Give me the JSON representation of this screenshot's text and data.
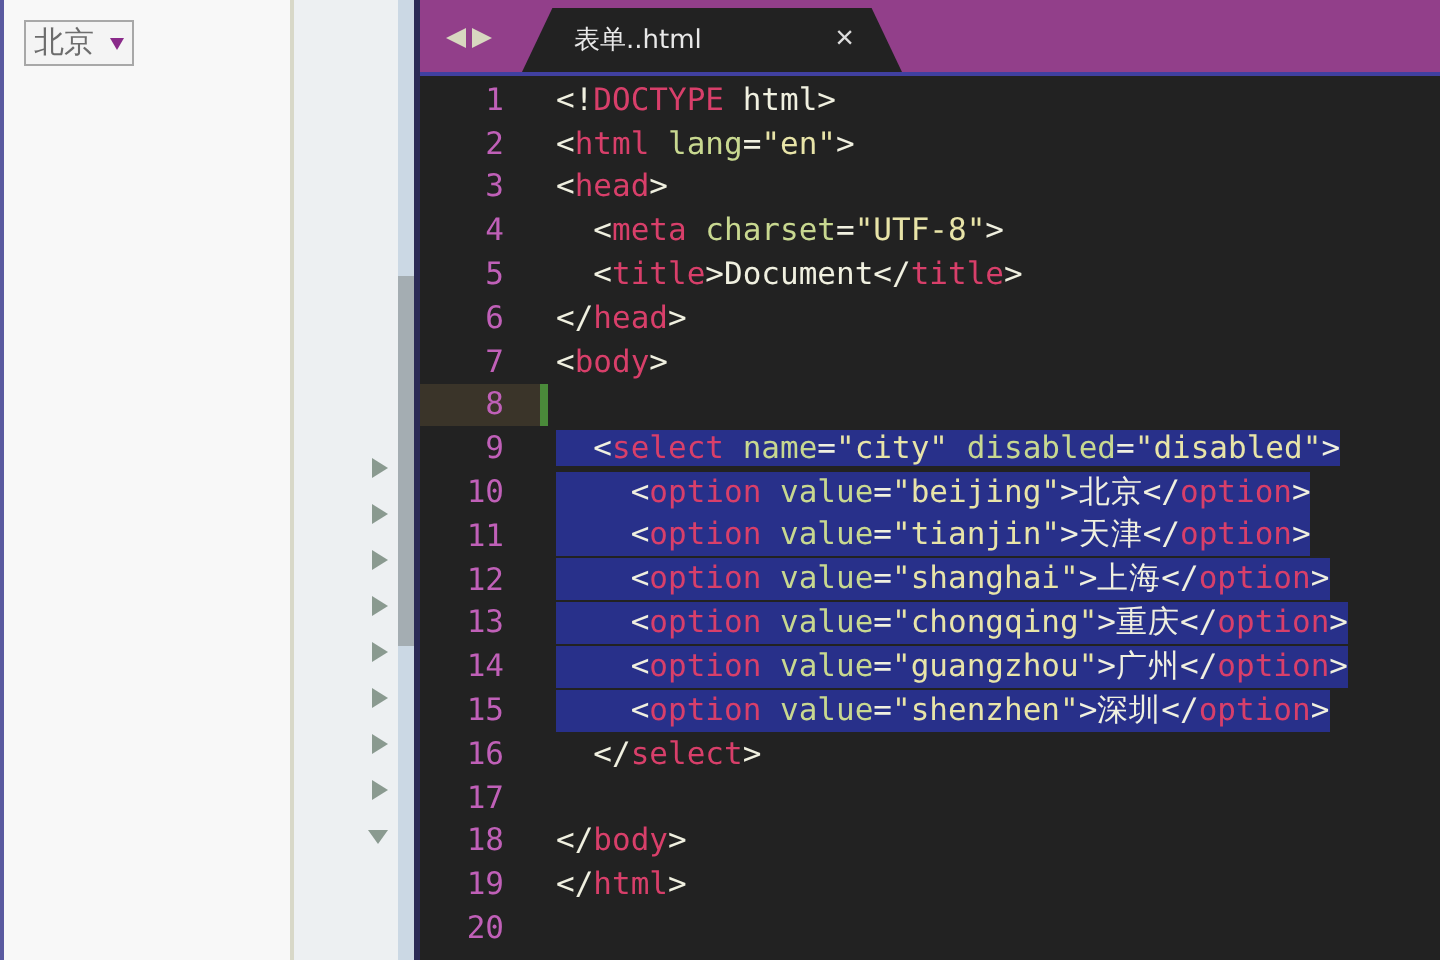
{
  "browser": {
    "select": {
      "value": "北京",
      "disabled": true
    }
  },
  "fold_markers": [
    {
      "kind": "collapsed"
    },
    {
      "kind": "collapsed"
    },
    {
      "kind": "collapsed"
    },
    {
      "kind": "collapsed"
    },
    {
      "kind": "collapsed"
    },
    {
      "kind": "collapsed"
    },
    {
      "kind": "collapsed"
    },
    {
      "kind": "collapsed"
    },
    {
      "kind": "expanded"
    }
  ],
  "editor": {
    "tab": {
      "title": "表单..html",
      "close": "×",
      "selected": true
    },
    "lines": [
      {
        "number": "1",
        "current": false,
        "selected": false,
        "tokens": [
          {
            "kind": "punct",
            "text": "<!"
          },
          {
            "kind": "tag",
            "text": "DOCTYPE"
          },
          {
            "kind": "plain",
            "text": " html>"
          }
        ]
      },
      {
        "number": "2",
        "current": false,
        "selected": false,
        "tokens": [
          {
            "kind": "punct",
            "text": "<"
          },
          {
            "kind": "tag",
            "text": "html"
          },
          {
            "kind": "attr",
            "text": " lang"
          },
          {
            "kind": "punct",
            "text": "="
          },
          {
            "kind": "string",
            "text": "\"en\""
          },
          {
            "kind": "punct",
            "text": ">"
          }
        ]
      },
      {
        "number": "3",
        "current": false,
        "selected": false,
        "tokens": [
          {
            "kind": "punct",
            "text": "<"
          },
          {
            "kind": "tag",
            "text": "head"
          },
          {
            "kind": "punct",
            "text": ">"
          }
        ]
      },
      {
        "number": "4",
        "current": false,
        "selected": false,
        "tokens": [
          {
            "kind": "punct",
            "text": "  <"
          },
          {
            "kind": "tag",
            "text": "meta"
          },
          {
            "kind": "attr",
            "text": " charset"
          },
          {
            "kind": "punct",
            "text": "="
          },
          {
            "kind": "string",
            "text": "\"UTF-8\""
          },
          {
            "kind": "punct",
            "text": ">"
          }
        ]
      },
      {
        "number": "5",
        "current": false,
        "selected": false,
        "tokens": [
          {
            "kind": "punct",
            "text": "  <"
          },
          {
            "kind": "tag",
            "text": "title"
          },
          {
            "kind": "plain",
            "text": ">Document</"
          },
          {
            "kind": "tag",
            "text": "title"
          },
          {
            "kind": "punct",
            "text": ">"
          }
        ]
      },
      {
        "number": "6",
        "current": false,
        "selected": false,
        "tokens": [
          {
            "kind": "punct",
            "text": "</"
          },
          {
            "kind": "tag",
            "text": "head"
          },
          {
            "kind": "punct",
            "text": ">"
          }
        ]
      },
      {
        "number": "7",
        "current": false,
        "selected": false,
        "tokens": [
          {
            "kind": "punct",
            "text": "<"
          },
          {
            "kind": "tag",
            "text": "body"
          },
          {
            "kind": "punct",
            "text": ">"
          }
        ]
      },
      {
        "number": "8",
        "current": true,
        "selected": false
      },
      {
        "number": "9",
        "current": false,
        "selected": true,
        "tokens": [
          {
            "kind": "punct",
            "text": "  <"
          },
          {
            "kind": "tag",
            "text": "select"
          },
          {
            "kind": "attr",
            "text": " name"
          },
          {
            "kind": "punct",
            "text": "="
          },
          {
            "kind": "string",
            "text": "\"city\""
          },
          {
            "kind": "attr",
            "text": " disabled"
          },
          {
            "kind": "punct",
            "text": "="
          },
          {
            "kind": "string",
            "text": "\"disabled\""
          },
          {
            "kind": "punct",
            "text": ">"
          }
        ]
      },
      {
        "number": "10",
        "current": false,
        "selected": true,
        "tokens": [
          {
            "kind": "punct",
            "text": "    <"
          },
          {
            "kind": "tag",
            "text": "option"
          },
          {
            "kind": "attr",
            "text": " value"
          },
          {
            "kind": "punct",
            "text": "="
          },
          {
            "kind": "string",
            "text": "\"beijing\""
          },
          {
            "kind": "plain",
            "text": ">北京</"
          },
          {
            "kind": "tag",
            "text": "option"
          },
          {
            "kind": "punct",
            "text": ">"
          }
        ]
      },
      {
        "number": "11",
        "current": false,
        "selected": true,
        "tokens": [
          {
            "kind": "punct",
            "text": "    <"
          },
          {
            "kind": "tag",
            "text": "option"
          },
          {
            "kind": "attr",
            "text": " value"
          },
          {
            "kind": "punct",
            "text": "="
          },
          {
            "kind": "string",
            "text": "\"tianjin\""
          },
          {
            "kind": "plain",
            "text": ">天津</"
          },
          {
            "kind": "tag",
            "text": "option"
          },
          {
            "kind": "punct",
            "text": ">"
          }
        ]
      },
      {
        "number": "12",
        "current": false,
        "selected": true,
        "tokens": [
          {
            "kind": "punct",
            "text": "    <"
          },
          {
            "kind": "tag",
            "text": "option"
          },
          {
            "kind": "attr",
            "text": " value"
          },
          {
            "kind": "punct",
            "text": "="
          },
          {
            "kind": "string",
            "text": "\"shanghai\""
          },
          {
            "kind": "plain",
            "text": ">上海</"
          },
          {
            "kind": "tag",
            "text": "option"
          },
          {
            "kind": "punct",
            "text": ">"
          }
        ]
      },
      {
        "number": "13",
        "current": false,
        "selected": true,
        "tokens": [
          {
            "kind": "punct",
            "text": "    <"
          },
          {
            "kind": "tag",
            "text": "option"
          },
          {
            "kind": "attr",
            "text": " value"
          },
          {
            "kind": "punct",
            "text": "="
          },
          {
            "kind": "string",
            "text": "\"chongqing\""
          },
          {
            "kind": "plain",
            "text": ">重庆</"
          },
          {
            "kind": "tag",
            "text": "option"
          },
          {
            "kind": "punct",
            "text": ">"
          }
        ]
      },
      {
        "number": "14",
        "current": false,
        "selected": true,
        "tokens": [
          {
            "kind": "punct",
            "text": "    <"
          },
          {
            "kind": "tag",
            "text": "option"
          },
          {
            "kind": "attr",
            "text": " value"
          },
          {
            "kind": "punct",
            "text": "="
          },
          {
            "kind": "string",
            "text": "\"guangzhou\""
          },
          {
            "kind": "plain",
            "text": ">广州</"
          },
          {
            "kind": "tag",
            "text": "option"
          },
          {
            "kind": "punct",
            "text": ">"
          }
        ]
      },
      {
        "number": "15",
        "current": false,
        "selected": true,
        "tokens": [
          {
            "kind": "punct",
            "text": "    <"
          },
          {
            "kind": "tag",
            "text": "option"
          },
          {
            "kind": "attr",
            "text": " value"
          },
          {
            "kind": "punct",
            "text": "="
          },
          {
            "kind": "string",
            "text": "\"shenzhen\""
          },
          {
            "kind": "plain",
            "text": ">深圳</"
          },
          {
            "kind": "tag",
            "text": "option"
          },
          {
            "kind": "punct",
            "text": ">"
          }
        ]
      },
      {
        "number": "16",
        "current": false,
        "selected": false,
        "tokens": [
          {
            "kind": "punct",
            "text": "  </"
          },
          {
            "kind": "tag",
            "text": "select"
          },
          {
            "kind": "punct",
            "text": ">"
          }
        ]
      },
      {
        "number": "17",
        "current": false,
        "selected": false
      },
      {
        "number": "18",
        "current": false,
        "selected": false,
        "tokens": [
          {
            "kind": "punct",
            "text": "</"
          },
          {
            "kind": "tag",
            "text": "body"
          },
          {
            "kind": "punct",
            "text": ">"
          }
        ]
      },
      {
        "number": "19",
        "current": false,
        "selected": false,
        "tokens": [
          {
            "kind": "punct",
            "text": "</"
          },
          {
            "kind": "tag",
            "text": "html"
          },
          {
            "kind": "punct",
            "text": ">"
          }
        ]
      },
      {
        "number": "20",
        "current": false,
        "selected": false
      }
    ]
  }
}
